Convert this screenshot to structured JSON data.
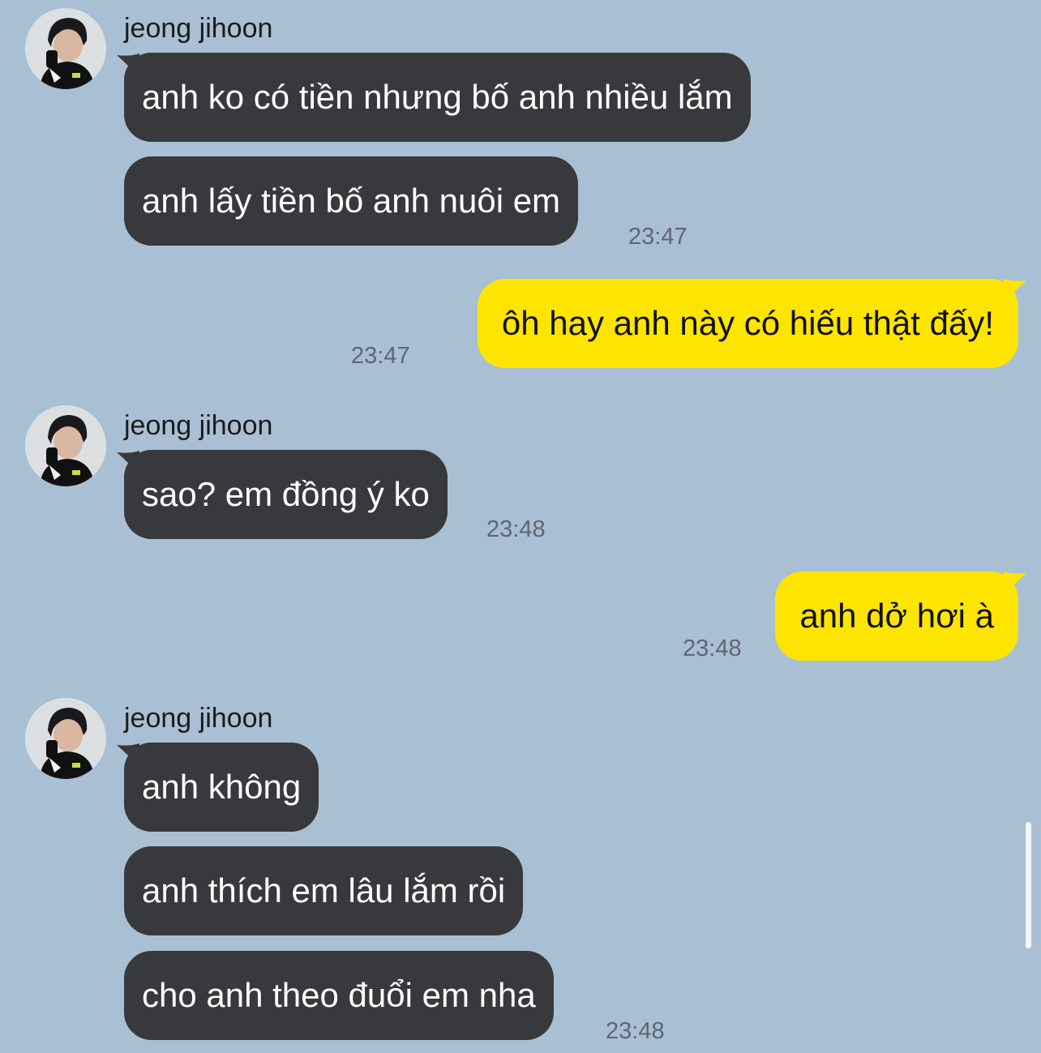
{
  "contact": {
    "name": "jeong jihoon"
  },
  "messages": [
    {
      "side": "in",
      "text": "anh ko có tiền nhưng bố anh nhiều lắm"
    },
    {
      "side": "in",
      "text": "anh lấy tiền bố anh nuôi em",
      "time": "23:47"
    },
    {
      "side": "out",
      "text": "ôh hay anh này có hiếu thật đấy!",
      "time": "23:47"
    },
    {
      "side": "in",
      "text": "sao? em đồng ý ko",
      "time": "23:48"
    },
    {
      "side": "out",
      "text": "anh dở hơi à",
      "time": "23:48"
    },
    {
      "side": "in",
      "text": "anh không"
    },
    {
      "side": "in",
      "text": "anh thích em lâu lắm rồi"
    },
    {
      "side": "in",
      "text": "cho anh theo đuổi em nha",
      "time": "23:48"
    }
  ],
  "colors": {
    "background": "#a9bfd3",
    "incoming_bubble": "#38393c",
    "outgoing_bubble": "#fee500",
    "timestamp": "#5d6772"
  },
  "icons": {
    "avatar": "profile-photo"
  }
}
